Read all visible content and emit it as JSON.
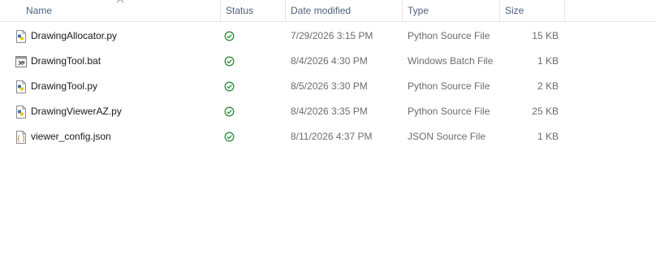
{
  "columns": {
    "name": "Name",
    "status": "Status",
    "date_modified": "Date modified",
    "type": "Type",
    "size": "Size"
  },
  "files": [
    {
      "name": "DrawingAllocator.py",
      "icon": "python-file-icon",
      "status": "synced-check-icon",
      "date": "7/29/2026 3:15 PM",
      "type": "Python Source File",
      "size": "15 KB"
    },
    {
      "name": "DrawingTool.bat",
      "icon": "batch-file-icon",
      "status": "synced-check-icon",
      "date": "8/4/2026 4:30 PM",
      "type": "Windows Batch File",
      "size": "1 KB"
    },
    {
      "name": "DrawingTool.py",
      "icon": "python-file-icon",
      "status": "synced-check-icon",
      "date": "8/5/2026 3:30 PM",
      "type": "Python Source File",
      "size": "2 KB"
    },
    {
      "name": "DrawingViewerAZ.py",
      "icon": "python-file-icon",
      "status": "synced-check-icon",
      "date": "8/4/2026 3:35 PM",
      "type": "Python Source File",
      "size": "25 KB"
    },
    {
      "name": "viewer_config.json",
      "icon": "json-file-icon",
      "status": "synced-check-icon",
      "date": "8/11/2026 4:37 PM",
      "type": "JSON Source File",
      "size": "1 KB"
    }
  ],
  "colors": {
    "header_text": "#4c607a",
    "status_green": "#2e8b3d",
    "secondary_text": "#6d6d6d"
  }
}
